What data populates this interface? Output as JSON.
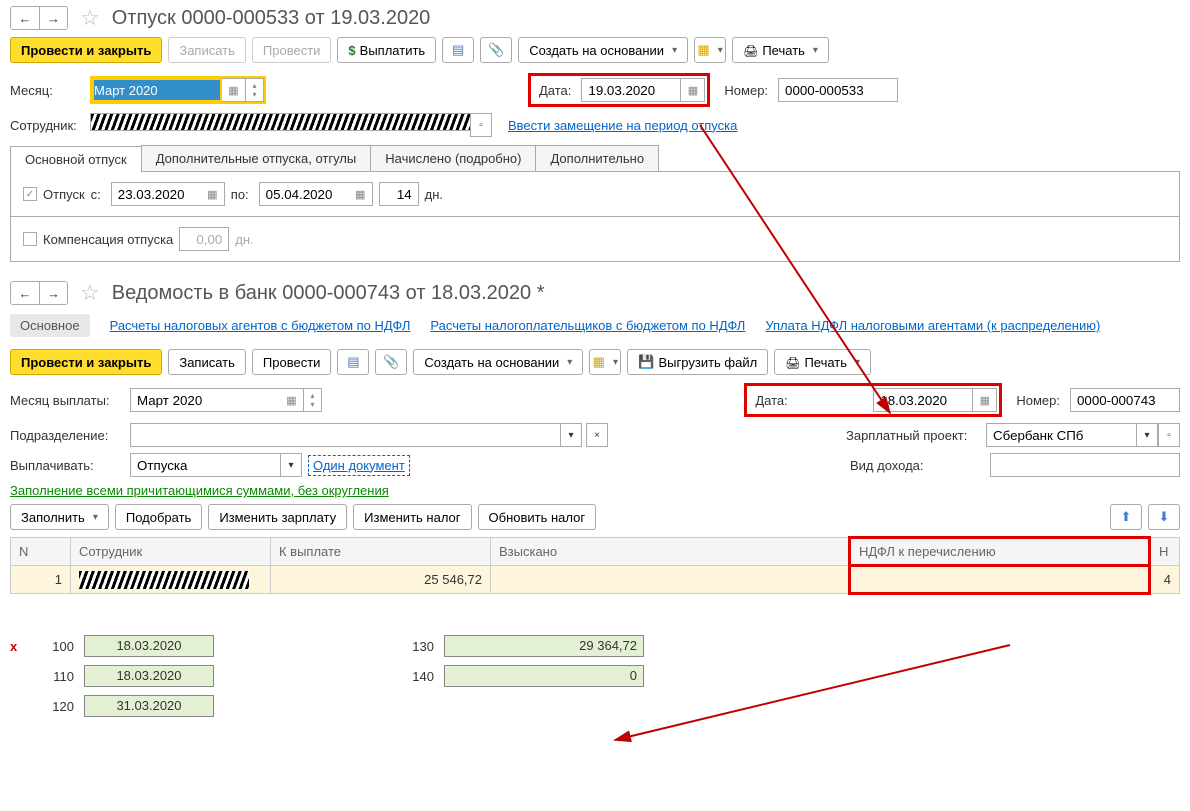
{
  "doc1": {
    "title": "Отпуск 0000-000533 от 19.03.2020",
    "toolbar": {
      "post_close": "Провести и закрыть",
      "save": "Записать",
      "post": "Провести",
      "pay": "Выплатить",
      "create_based": "Создать на основании",
      "print": "Печать"
    },
    "month_label": "Месяц:",
    "month_value": "Март 2020",
    "date_label": "Дата:",
    "date_value": "19.03.2020",
    "number_label": "Номер:",
    "number_value": "0000-000533",
    "employee_label": "Сотрудник:",
    "sub_link": "Ввести замещение на период отпуска",
    "tabs": {
      "main": "Основной отпуск",
      "extra": "Дополнительные отпуска, отгулы",
      "accrued": "Начислено (подробно)",
      "additional": "Дополнительно"
    },
    "vac_check": "Отпуск",
    "from_label": "с:",
    "from_value": "23.03.2020",
    "to_label": "по:",
    "to_value": "05.04.2020",
    "days_value": "14",
    "days_label": "дн.",
    "comp_label": "Компенсация отпуска",
    "comp_value": "0,00",
    "comp_days": "дн."
  },
  "doc2": {
    "title": "Ведомость в банк 0000-000743 от 18.03.2020 *",
    "linkbar": {
      "main": "Основное",
      "l1": "Расчеты налоговых агентов с бюджетом по НДФЛ",
      "l2": "Расчеты налогоплательщиков с бюджетом по НДФЛ",
      "l3": "Уплата НДФЛ налоговыми агентами (к распределению)"
    },
    "toolbar": {
      "post_close": "Провести и закрыть",
      "save": "Записать",
      "post": "Провести",
      "create_based": "Создать на основании",
      "export": "Выгрузить файл",
      "print": "Печать"
    },
    "month_label": "Месяц выплаты:",
    "month_value": "Март 2020",
    "date_label": "Дата:",
    "date_value": "18.03.2020",
    "number_label": "Номер:",
    "number_value": "0000-000743",
    "dept_label": "Подразделение:",
    "proj_label": "Зарплатный проект:",
    "proj_value": "Сбербанк СПб",
    "pay_label": "Выплачивать:",
    "pay_value": "Отпуска",
    "one_doc": "Один документ",
    "income_label": "Вид дохода:",
    "fill_link": "Заполнение всеми причитающимися суммами, без округления",
    "buttons": {
      "fill": "Заполнить",
      "pick": "Подобрать",
      "change_salary": "Изменить зарплату",
      "change_tax": "Изменить налог",
      "update_tax": "Обновить налог"
    },
    "table": {
      "headers": {
        "n": "N",
        "emp": "Сотрудник",
        "pay": "К выплате",
        "levied": "Взыскано",
        "ndfl": "НДФЛ к перечислению",
        "last": "Н"
      },
      "row": {
        "n": "1",
        "pay": "25 546,72",
        "last": "4"
      }
    }
  },
  "tax": {
    "r1": {
      "code": "100",
      "val": "18.03.2020"
    },
    "r2": {
      "code": "110",
      "val": "18.03.2020"
    },
    "r3": {
      "code": "120",
      "val": "31.03.2020"
    },
    "r4": {
      "code": "130",
      "val": "29 364,72"
    },
    "r5": {
      "code": "140",
      "val": "0"
    }
  }
}
